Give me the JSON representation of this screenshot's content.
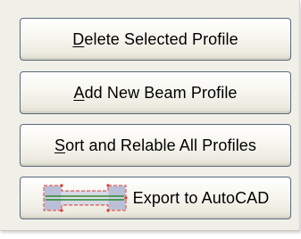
{
  "buttons": [
    {
      "first": "D",
      "rest": "elete Selected Profile"
    },
    {
      "first": "A",
      "rest": "dd New Beam Profile"
    },
    {
      "first": "S",
      "rest": "ort and Relable All Profiles"
    },
    {
      "label": "Export to AutoCAD",
      "icon": "beam-profile-icon"
    }
  ],
  "colors": {
    "panel": "#f0efe8",
    "button_border": "#5b6a7d",
    "icon_outline": "#e03b2e",
    "icon_beam": "#2e8a2e"
  }
}
